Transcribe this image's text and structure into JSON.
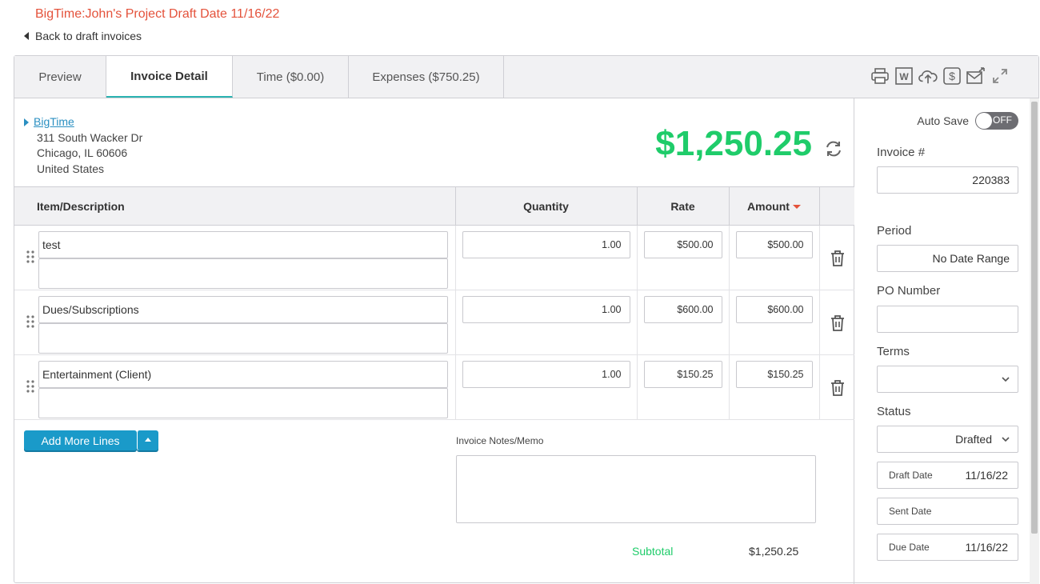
{
  "header": {
    "title": "BigTime:John's Project Draft Date 11/16/22",
    "back_label": "Back to draft invoices"
  },
  "tabs": [
    {
      "label": "Preview"
    },
    {
      "label": "Invoice Detail"
    },
    {
      "label": "Time ($0.00)"
    },
    {
      "label": "Expenses ($750.25)"
    }
  ],
  "toolbar_icons": [
    "print-icon",
    "word-icon",
    "cloud-upload-icon",
    "dollar-icon",
    "email-icon",
    "expand-icon"
  ],
  "client": {
    "name": "BigTime",
    "address_line1": "311 South Wacker Dr",
    "address_line2": "Chicago, IL 60606",
    "address_line3": "United States"
  },
  "total": "$1,250.25",
  "table": {
    "headers": {
      "item": "Item/Description",
      "quantity": "Quantity",
      "rate": "Rate",
      "amount": "Amount"
    },
    "rows": [
      {
        "item": "test",
        "detail": "",
        "quantity": "1.00",
        "rate": "$500.00",
        "amount": "$500.00"
      },
      {
        "item": "Dues/Subscriptions",
        "detail": "",
        "quantity": "1.00",
        "rate": "$600.00",
        "amount": "$600.00"
      },
      {
        "item": "Entertainment (Client)",
        "detail": "",
        "quantity": "1.00",
        "rate": "$150.25",
        "amount": "$150.25"
      }
    ]
  },
  "footer": {
    "add_lines_label": "Add More Lines",
    "notes_label": "Invoice Notes/Memo",
    "notes_value": "",
    "subtotal_label": "Subtotal",
    "subtotal_value": "$1,250.25"
  },
  "sidebar": {
    "autosave_label": "Auto Save",
    "autosave_state": "OFF",
    "invoice_label": "Invoice #",
    "invoice_value": "220383",
    "period_label": "Period",
    "period_value": "No Date Range",
    "po_label": "PO Number",
    "po_value": "",
    "terms_label": "Terms",
    "terms_value": "",
    "status_label": "Status",
    "status_value": "Drafted",
    "draft_date_label": "Draft Date",
    "draft_date_value": "11/16/22",
    "sent_date_label": "Sent Date",
    "sent_date_value": "",
    "due_date_label": "Due Date",
    "due_date_value": "11/16/22"
  },
  "colors": {
    "title": "#e4523b",
    "accent": "#2bb3b1",
    "total": "#1fcc6a",
    "button": "#1a9ac9"
  }
}
